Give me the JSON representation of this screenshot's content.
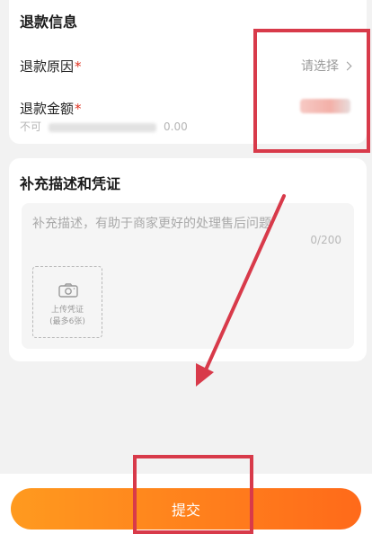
{
  "refund_info": {
    "title": "退款信息",
    "reason_label": "退款原因",
    "required_mark": "*",
    "reason_placeholder": "请选择",
    "amount_label": "退款金额",
    "note_prefix": "不可",
    "note_amount": "0.00"
  },
  "description": {
    "title": "补充描述和凭证",
    "placeholder": "补充描述，有助于商家更好的处理售后问题",
    "counter": "0/200",
    "upload_label": "上传凭证",
    "upload_hint": "(最多6张)"
  },
  "submit": {
    "label": "提交"
  },
  "colors": {
    "accent_start": "#ff9a1f",
    "accent_end": "#ff6a1a",
    "required": "#e0301e",
    "annotation": "#d83a4a"
  },
  "icons": {
    "reason_chevron": "chevron-right-icon",
    "upload": "camera-icon"
  }
}
